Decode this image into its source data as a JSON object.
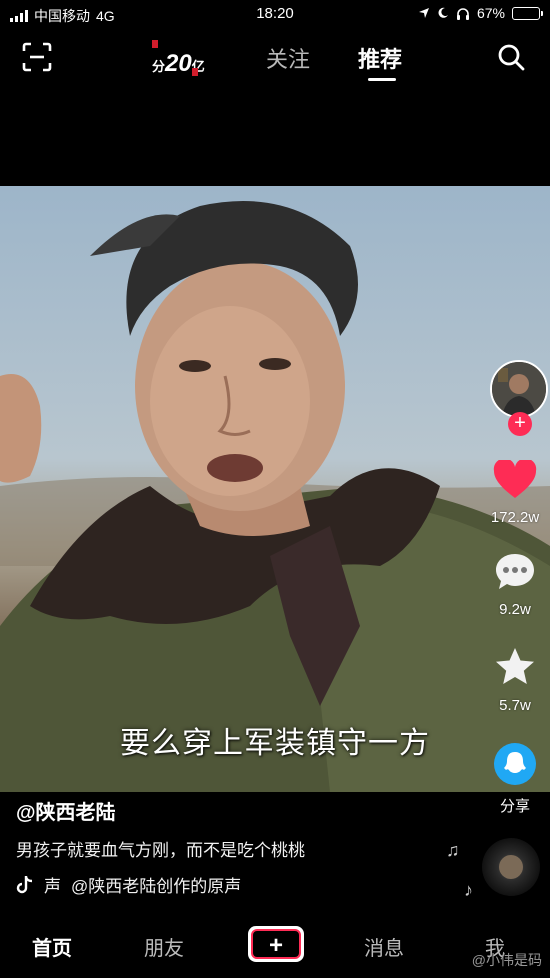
{
  "status_bar": {
    "carrier": "中国移动",
    "network": "4G",
    "time": "18:20",
    "battery": "67%",
    "battery_level": 0.67
  },
  "top_nav": {
    "promo_prefix": "分",
    "promo_amount": "20",
    "promo_suffix": "亿",
    "tab_follow": "关注",
    "tab_recommend": "推荐"
  },
  "video": {
    "subtitle": "要么穿上军装镇守一方"
  },
  "rail": {
    "likes": "172.2w",
    "comments": "9.2w",
    "favorites": "5.7w",
    "share": "分享"
  },
  "post": {
    "author": "@陕西老陆",
    "caption": "男孩子就要血气方刚，而不是吃个桃桃",
    "music_prefix": "声",
    "music": "@陕西老陆创作的原声"
  },
  "bottom_nav": {
    "home": "首页",
    "friends": "朋友",
    "messages": "消息",
    "me": "我"
  },
  "watermark": "@小伟是码",
  "colors": {
    "accent": "#fe2c55",
    "like": "#fe2c55",
    "share": "#20a8f4",
    "favorite": "#ffffff",
    "battery": "#f3c21b"
  }
}
